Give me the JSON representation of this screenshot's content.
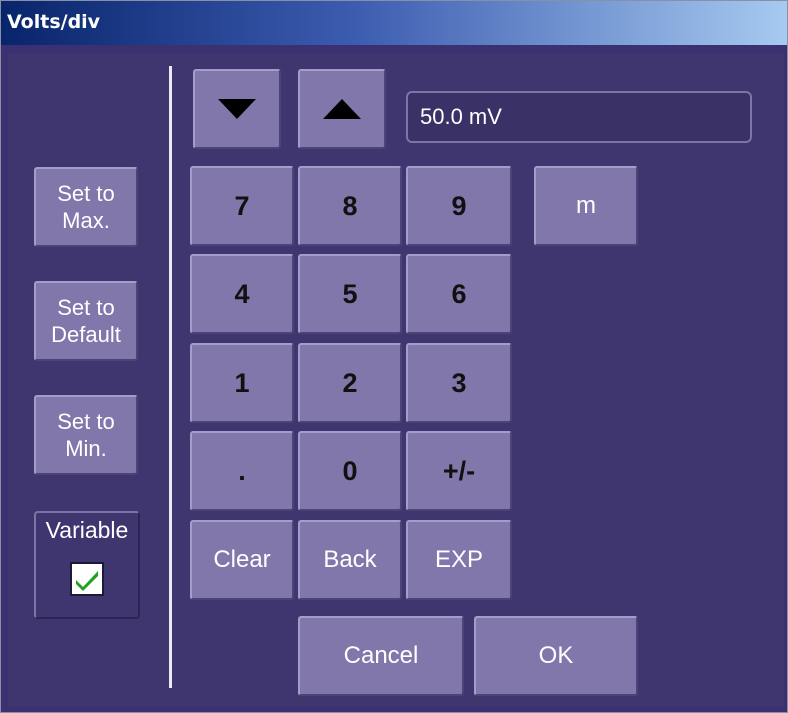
{
  "window": {
    "title": "Volts/div"
  },
  "display": {
    "value": "50.0 mV"
  },
  "side": {
    "set_max": "Set to\nMax.",
    "set_default": "Set to\nDefault",
    "set_min": "Set to\nMin.",
    "variable_label": "Variable",
    "variable_checked": true
  },
  "keypad": {
    "k7": "7",
    "k8": "8",
    "k9": "9",
    "k4": "4",
    "k5": "5",
    "k6": "6",
    "k1": "1",
    "k2": "2",
    "k3": "3",
    "kdot": ".",
    "k0": "0",
    "kpm": "+/-",
    "clear": "Clear",
    "back": "Back",
    "exp": "EXP",
    "unit_m": "m"
  },
  "footer": {
    "cancel": "Cancel",
    "ok": "OK"
  },
  "colors": {
    "panel": "#3f356f",
    "button": "#8277ab",
    "check": "#21a121"
  },
  "icons": {
    "down": "triangle-down-icon",
    "up": "triangle-up-icon",
    "check": "checkmark-icon"
  }
}
